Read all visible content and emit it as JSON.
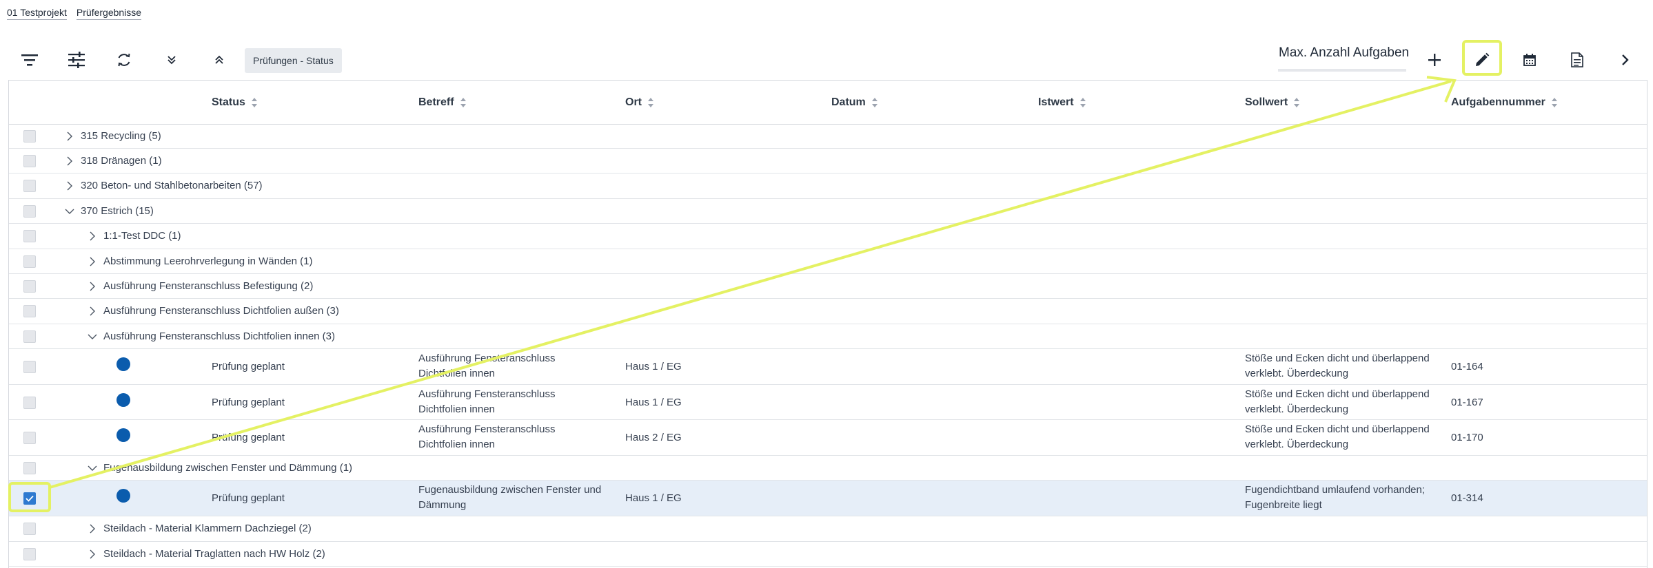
{
  "breadcrumb": [
    "01 Testprojekt",
    "Prüfergebnisse"
  ],
  "toolbar": {
    "chip_label": "Prüfungen - Status",
    "max_label": "Max. Anzahl Aufgaben",
    "max_progress": 0,
    "icons": [
      "filter-icon",
      "sliders-icon",
      "refresh-icon",
      "expand-all-icon",
      "collapse-all-icon",
      "plus-icon",
      "pencil-icon",
      "calendar-icon",
      "document-icon",
      "chevron-right-icon"
    ]
  },
  "columns": [
    "Status",
    "Betreff",
    "Ort",
    "Datum",
    "Istwert",
    "Sollwert",
    "Aufgabennummer"
  ],
  "groups": {
    "g315": "315 Recycling (5)",
    "g318": "318 Dränagen (1)",
    "g320": "320 Beton- und Stahlbetonarbeiten (57)",
    "g370": "370 Estrich (15)",
    "s1": "1:1-Test DDC (1)",
    "s2": "Abstimmung Leerohrverlegung in Wänden (1)",
    "s3": "Ausführung Fensteranschluss Befestigung (2)",
    "s4": "Ausführung Fensteranschluss Dichtfolien außen (3)",
    "s5": "Ausführung Fensteranschluss Dichtfolien innen (3)",
    "s6": "Fugenausbildung zwischen Fenster und Dämmung (1)",
    "s7": "Steildach - Material Klammern Dachziegel (2)",
    "s8": "Steildach - Material Traglatten nach HW Holz (2)"
  },
  "rows": [
    {
      "status": "Prüfung geplant",
      "betreff": "Ausführung Fensteranschluss Dichtfolien innen",
      "ort": "Haus 1 / EG",
      "sollwert": "Stöße und Ecken dicht und überlappend verklebt. Überdeckung",
      "nummer": "01-164"
    },
    {
      "status": "Prüfung geplant",
      "betreff": "Ausführung Fensteranschluss Dichtfolien innen",
      "ort": "Haus 1 / EG",
      "sollwert": "Stöße und Ecken dicht und überlappend verklebt. Überdeckung",
      "nummer": "01-167"
    },
    {
      "status": "Prüfung geplant",
      "betreff": "Ausführung Fensteranschluss Dichtfolien innen",
      "ort": "Haus 2 / EG",
      "sollwert": "Stöße und Ecken dicht und überlappend verklebt. Überdeckung",
      "nummer": "01-170"
    },
    {
      "status": "Prüfung geplant",
      "betreff": "Fugenausbildung zwischen Fenster und Dämmung",
      "ort": "Haus 1 / EG",
      "sollwert": "Fugendichtband umlaufend vorhanden; Fugenbreite liegt",
      "nummer": "01-314"
    }
  ],
  "colors": {
    "accent": "#2f7ad0",
    "status_dot": "#0b5cad",
    "annotation": "#e4f163",
    "selected_row": "#e6eef8"
  }
}
